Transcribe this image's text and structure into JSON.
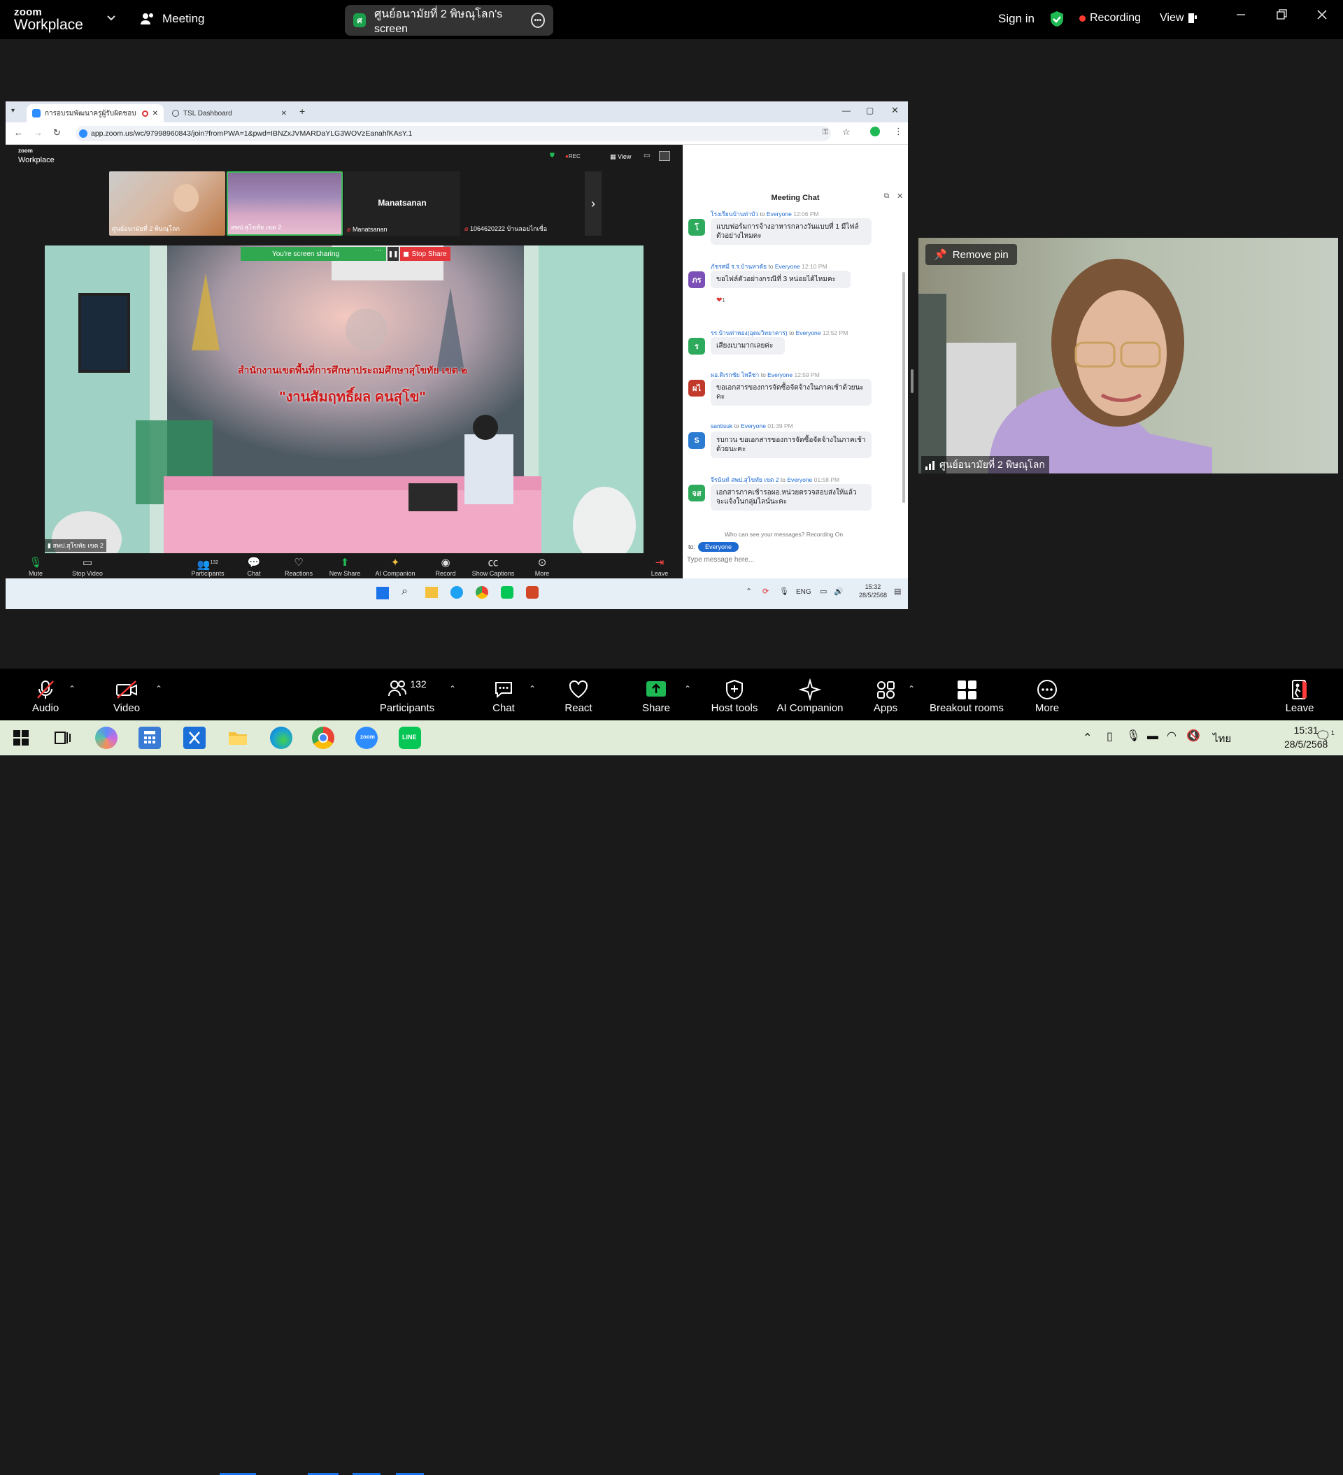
{
  "app": {
    "logo_line1": "zoom",
    "logo_line2": "Workplace",
    "meeting_label": "Meeting",
    "share_title": "ศูนย์อนามัยที่ 2 พิษณุโลก's screen",
    "share_badge": "ศ",
    "sign_in": "Sign in",
    "recording": "Recording",
    "view": "View"
  },
  "browser": {
    "tab1": "การอบรมพัฒนาครูผู้รับผิดชอบ",
    "tab2": "TSL Dashboard",
    "url": "app.zoom.us/wc/97998960843/join?fromPWA=1&pwd=IBNZxJVMARDaYLG3WOVzEanahfKAsY.1"
  },
  "inner": {
    "logo_line1": "zoom",
    "logo_line2": "Workplace",
    "rec": "REC",
    "view": "View",
    "thumbs": [
      {
        "name": "ศูนย์อนามัยที่ 2 พิษณุโลก"
      },
      {
        "name": "สพป.สุโขทัย เขต 2"
      },
      {
        "name": "Manatsanan",
        "center": "Manatsanan"
      },
      {
        "name": "1064620222 บ้านลอยไกเชื่อ"
      }
    ],
    "sharing_text": "You're screen sharing",
    "stop_share": "Stop Share",
    "screen_name": "สพป.สุโขทัย เขต 2",
    "banner_line1": "สำนักงานเขตพื้นที่การศึกษาประถมศึกษาสุโขทัย เขต ๒",
    "banner_line2": "\"งานสัมฤทธิ์ผล คนสุโข\"",
    "participants_count": "132",
    "toolbar": [
      "Mute",
      "Stop Video",
      "Participants",
      "Chat",
      "Reactions",
      "New Share",
      "AI Companion",
      "Record",
      "Show Captions",
      "More",
      "Leave"
    ],
    "chat_title": "Meeting Chat",
    "messages": [
      {
        "sender": "โรงเรียนบ้านท่าบัว",
        "to": "to",
        "target": "Everyone",
        "time": "12:06 PM",
        "avatar": "โ",
        "color": "#2eaa5c",
        "text": "แบบฟอร์มการจ้างอาหารกลางวันแบบที่ 1 มีไฟล์ตัวอย่างไหมคะ"
      },
      {
        "sender": "ภัชรศมี ร.ร.บ้านหาดัย",
        "to": "to",
        "target": "Everyone",
        "time": "12:10 PM",
        "avatar": "ภร",
        "color": "#7b4fb5",
        "text": "ขอไฟล์ตัวอย่างกรณีที่ 3 หน่อยได้ไหมคะ",
        "reaction": "1"
      },
      {
        "sender": "รร.บ้านท่าหอง(อุดมวิทยาคาร)",
        "to": "to",
        "target": "Everyone",
        "time": "12:52 PM",
        "avatar": "ร",
        "color": "#2eaa5c",
        "text": "เสียงเบามากเลยค่ะ"
      },
      {
        "sender": "ผอ.ดิเรกชัย ไหลีชา",
        "to": "to",
        "target": "Everyone",
        "time": "12:59 PM",
        "avatar": "ผไ",
        "color": "#c0392b",
        "text": "ขอเอกสารของการจัดซื้อจัดจ้างในภาคเช้าด้วยนะคะ"
      },
      {
        "sender": "santisuk",
        "to": "to",
        "target": "Everyone",
        "time": "01:39 PM",
        "avatar": "S",
        "color": "#2b7bd1",
        "text": "รบกวน ขอเอกสารของการจัดซื้อจัดจ้างในภาคเช้าด้วยนะคะ"
      },
      {
        "sender": "จีรนันท์ สพป.สุโขทัย เขต 2",
        "to": "to",
        "target": "Everyone",
        "time": "01:58 PM",
        "avatar": "จส",
        "color": "#2eaa5c",
        "text": "เอกสารภาคเช้ารอผอ.หน่วยตรวจสอบส่งให้แล้วจะแจ้งในกลุ่มไลน์นะคะ"
      }
    ],
    "chat_notice": "Who can see your messages? Recording On",
    "chat_to": "to:",
    "chat_target": "Everyone",
    "chat_placeholder": "Type message here...",
    "tray_lang": "ENG",
    "tray_time": "15:32",
    "tray_date": "28/5/2568"
  },
  "pinned": {
    "remove_pin": "Remove pin",
    "name": "ศูนย์อนามัยที่ 2 พิษณุโลก"
  },
  "toolbar": {
    "audio": "Audio",
    "video": "Video",
    "participants": "Participants",
    "participants_count": "132",
    "chat": "Chat",
    "react": "React",
    "share": "Share",
    "host_tools": "Host tools",
    "ai_companion": "AI Companion",
    "apps": "Apps",
    "breakout": "Breakout rooms",
    "more": "More",
    "leave": "Leave"
  },
  "taskbar": {
    "lang": "ไทย",
    "time": "15:31",
    "date": "28/5/2568",
    "notif": "1"
  }
}
